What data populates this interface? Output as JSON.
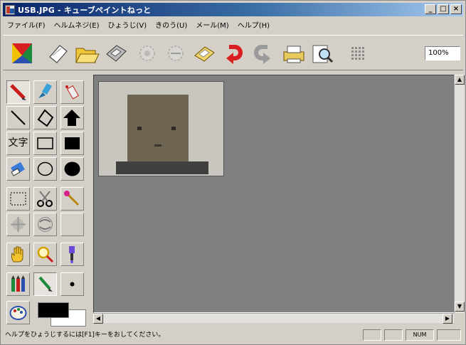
{
  "window": {
    "title": "USB.JPG - キューブペイントねっと",
    "controls": {
      "minimize": "_",
      "maximize": "□",
      "close": "×"
    }
  },
  "menu": {
    "items": [
      {
        "label": "ファイル(F)"
      },
      {
        "label": "ヘルムネジ(E)"
      },
      {
        "label": "ひょうじ(V)"
      },
      {
        "label": "きのう(U)"
      },
      {
        "label": "メール(M)"
      },
      {
        "label": "ヘルプ(H)"
      }
    ]
  },
  "toolbar": {
    "icons": [
      "logo-icon",
      "new-icon",
      "open-icon",
      "save-icon",
      "undo-icon",
      "redo-icon",
      "scan-icon",
      "red-arrow-icon",
      "gray-arrow-icon",
      "print-icon",
      "print-preview-icon",
      "grid-icon"
    ],
    "zoom_value": "100%"
  },
  "tools": {
    "text_label": "文字",
    "icons": [
      "pencil-icon",
      "brush-icon",
      "spray-icon",
      "line-icon",
      "polygon-icon",
      "fill-polygon-icon",
      "text-icon",
      "rectangle-icon",
      "filled-rectangle-icon",
      "eraser-icon",
      "ellipse-icon",
      "filled-ellipse-icon",
      "select-rect-icon",
      "scissors-icon",
      "magic-wand-icon",
      "effect-icon",
      "stamp-icon",
      "blank-icon",
      "hand-icon",
      "magnifier-icon",
      "dropper-icon",
      "color-pencils-icon",
      "pen-icon",
      "dot-icon",
      "palette-icon"
    ]
  },
  "colors": {
    "foreground": "#000000",
    "background": "#ffffff",
    "canvas": "#808080"
  },
  "status": {
    "message": "ヘルプをひょうじするには[F1]キーをおしてください。",
    "num": "NUM"
  }
}
